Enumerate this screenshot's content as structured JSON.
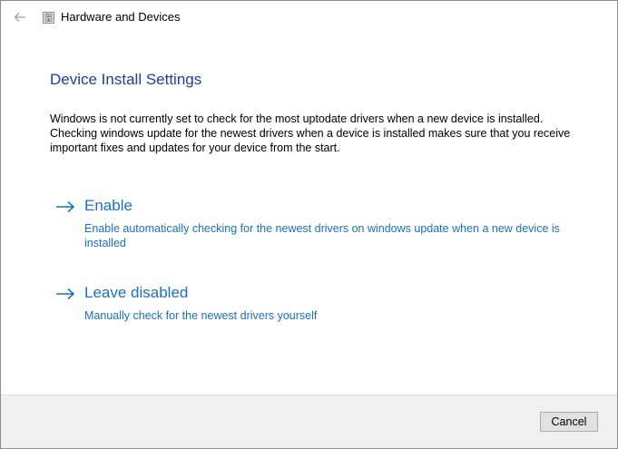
{
  "window": {
    "title": "Hardware and Devices",
    "back_icon": "back-arrow-icon",
    "app_icon": "hardware-devices-icon"
  },
  "main": {
    "heading": "Device Install Settings",
    "description": "Windows is not currently set to check for the most uptodate drivers when a new device is installed. Checking windows update for the newest drivers when a device is installed makes sure that you receive important fixes and updates for your device from the start.",
    "options": [
      {
        "label": "Enable",
        "description": "Enable automatically checking for the newest drivers on windows update when a new device is installed",
        "icon": "arrow-right-icon"
      },
      {
        "label": "Leave disabled",
        "description": "Manually check for the newest drivers yourself",
        "icon": "arrow-right-icon"
      }
    ]
  },
  "footer": {
    "cancel_label": "Cancel"
  },
  "colors": {
    "heading": "#1f3f96",
    "link": "#1b6fbf",
    "footer_bg": "#f0f0f0"
  }
}
